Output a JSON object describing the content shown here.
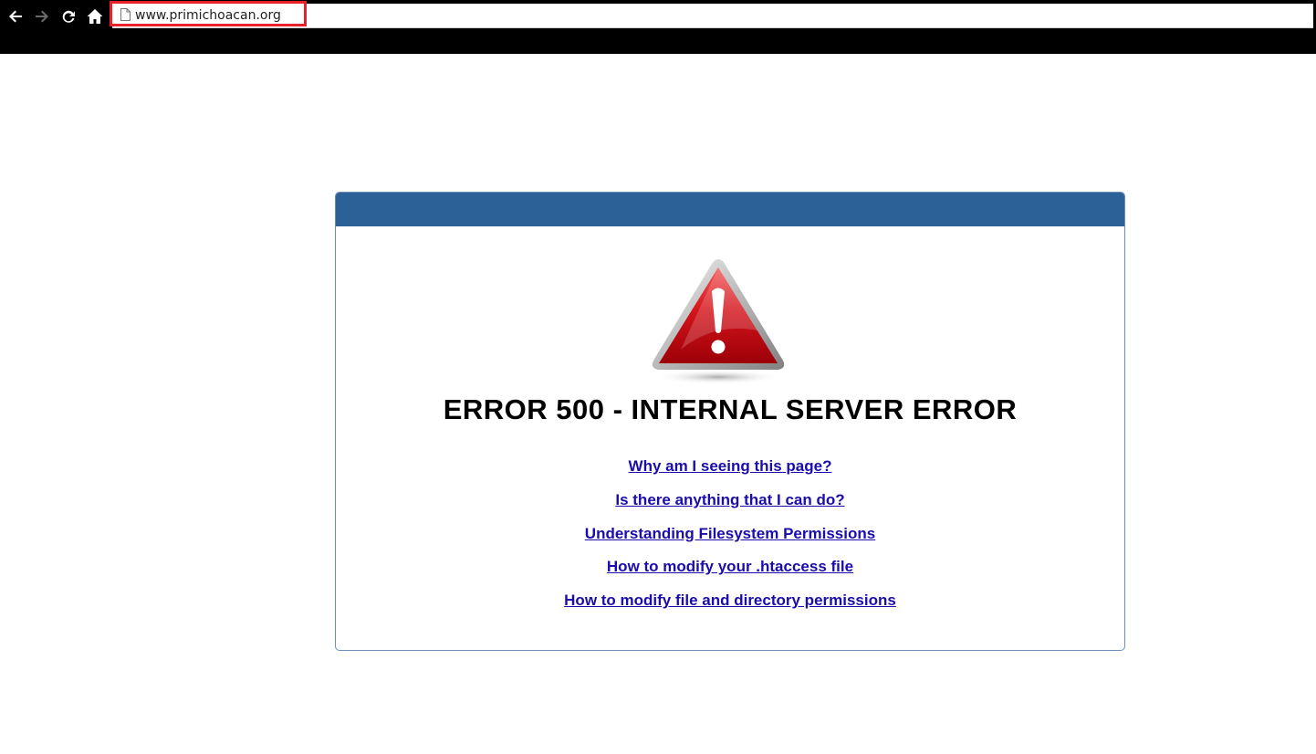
{
  "browser": {
    "url": "www.primichoacan.org",
    "back_icon": "back-arrow-icon",
    "forward_icon": "forward-arrow-icon",
    "reload_icon": "reload-icon",
    "home_icon": "home-icon",
    "highlight_color": "#e8202a"
  },
  "error_page": {
    "header_color": "#2c6198",
    "icon": "warning-triangle-icon",
    "title": "ERROR 500 - INTERNAL SERVER ERROR",
    "links": [
      "Why am I seeing this page?",
      "Is there anything that I can do?",
      "Understanding Filesystem Permissions",
      "How to modify your .htaccess file",
      "How to modify file and directory permissions"
    ]
  }
}
